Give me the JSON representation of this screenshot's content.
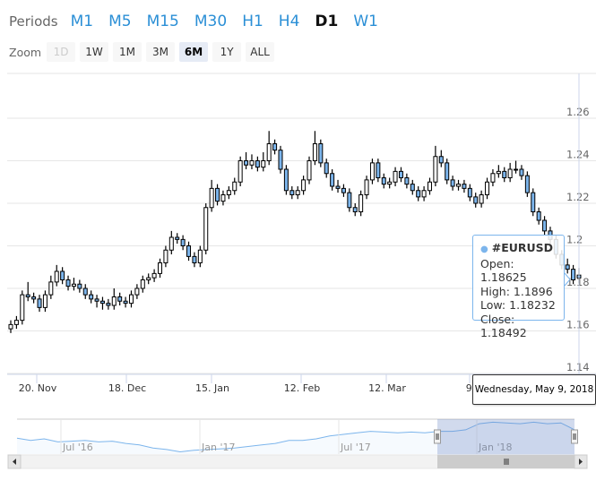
{
  "periods": {
    "label": "Periods",
    "items": [
      "M1",
      "M5",
      "M15",
      "M30",
      "H1",
      "H4",
      "D1",
      "W1"
    ],
    "active": "D1"
  },
  "zoom": {
    "label": "Zoom",
    "items": [
      "1D",
      "1W",
      "1M",
      "3M",
      "6M",
      "1Y",
      "ALL"
    ],
    "disabled": "1D",
    "selected": "6M"
  },
  "tooltip": {
    "symbol": "#EURUSD",
    "open": "Open: 1.18625",
    "high": "High: 1.1896",
    "low": "Low: 1.18232",
    "close": "Close: 1.18492",
    "date": "Wednesday, May 9, 2018"
  },
  "colors": {
    "down": "#7cb5ec",
    "up": "#ffffff",
    "line": "#000000",
    "grid": "#e6e6e6",
    "accent": "#2b8fd6"
  },
  "chart_data": {
    "type": "candlestick",
    "title": "",
    "series_name": "#EURUSD",
    "ylim": [
      1.14,
      1.26
    ],
    "y_ticks": [
      "1.14",
      "1.16",
      "1.18",
      "1.2",
      "1.22",
      "1.24",
      "1.26"
    ],
    "x_ticks": [
      "20. Nov",
      "18. Dec",
      "15. Jan",
      "12. Feb",
      "12. Mar",
      "9."
    ],
    "ohlc": [
      [
        1.161,
        1.165,
        1.159,
        1.163
      ],
      [
        1.163,
        1.167,
        1.161,
        1.165
      ],
      [
        1.165,
        1.179,
        1.163,
        1.177
      ],
      [
        1.177,
        1.183,
        1.174,
        1.176
      ],
      [
        1.176,
        1.178,
        1.173,
        1.175
      ],
      [
        1.175,
        1.177,
        1.169,
        1.171
      ],
      [
        1.171,
        1.179,
        1.169,
        1.177
      ],
      [
        1.177,
        1.186,
        1.175,
        1.183
      ],
      [
        1.183,
        1.191,
        1.181,
        1.188
      ],
      [
        1.188,
        1.19,
        1.182,
        1.184
      ],
      [
        1.184,
        1.186,
        1.179,
        1.181
      ],
      [
        1.181,
        1.185,
        1.179,
        1.182
      ],
      [
        1.182,
        1.184,
        1.178,
        1.18
      ],
      [
        1.18,
        1.182,
        1.175,
        1.177
      ],
      [
        1.177,
        1.179,
        1.173,
        1.175
      ],
      [
        1.175,
        1.177,
        1.171,
        1.174
      ],
      [
        1.174,
        1.176,
        1.17,
        1.173
      ],
      [
        1.173,
        1.175,
        1.17,
        1.172
      ],
      [
        1.172,
        1.18,
        1.17,
        1.176
      ],
      [
        1.176,
        1.178,
        1.172,
        1.174
      ],
      [
        1.174,
        1.176,
        1.171,
        1.173
      ],
      [
        1.173,
        1.179,
        1.171,
        1.177
      ],
      [
        1.177,
        1.182,
        1.175,
        1.18
      ],
      [
        1.18,
        1.186,
        1.178,
        1.184
      ],
      [
        1.184,
        1.187,
        1.182,
        1.185
      ],
      [
        1.185,
        1.189,
        1.183,
        1.187
      ],
      [
        1.187,
        1.194,
        1.185,
        1.192
      ],
      [
        1.192,
        1.2,
        1.19,
        1.198
      ],
      [
        1.198,
        1.207,
        1.196,
        1.204
      ],
      [
        1.204,
        1.206,
        1.201,
        1.203
      ],
      [
        1.203,
        1.205,
        1.198,
        1.2
      ],
      [
        1.2,
        1.202,
        1.193,
        1.195
      ],
      [
        1.195,
        1.197,
        1.19,
        1.192
      ],
      [
        1.192,
        1.2,
        1.19,
        1.198
      ],
      [
        1.198,
        1.22,
        1.196,
        1.218
      ],
      [
        1.218,
        1.231,
        1.216,
        1.227
      ],
      [
        1.227,
        1.229,
        1.219,
        1.221
      ],
      [
        1.221,
        1.226,
        1.219,
        1.224
      ],
      [
        1.224,
        1.228,
        1.222,
        1.226
      ],
      [
        1.226,
        1.232,
        1.224,
        1.23
      ],
      [
        1.23,
        1.242,
        1.228,
        1.24
      ],
      [
        1.24,
        1.244,
        1.236,
        1.238
      ],
      [
        1.238,
        1.243,
        1.236,
        1.24
      ],
      [
        1.24,
        1.242,
        1.235,
        1.237
      ],
      [
        1.237,
        1.244,
        1.235,
        1.24
      ],
      [
        1.24,
        1.254,
        1.238,
        1.248
      ],
      [
        1.248,
        1.25,
        1.243,
        1.245
      ],
      [
        1.245,
        1.247,
        1.234,
        1.236
      ],
      [
        1.236,
        1.238,
        1.224,
        1.226
      ],
      [
        1.226,
        1.228,
        1.222,
        1.224
      ],
      [
        1.224,
        1.228,
        1.222,
        1.226
      ],
      [
        1.226,
        1.233,
        1.224,
        1.231
      ],
      [
        1.231,
        1.242,
        1.229,
        1.24
      ],
      [
        1.24,
        1.254,
        1.238,
        1.248
      ],
      [
        1.248,
        1.25,
        1.237,
        1.239
      ],
      [
        1.239,
        1.241,
        1.232,
        1.234
      ],
      [
        1.234,
        1.236,
        1.226,
        1.228
      ],
      [
        1.228,
        1.231,
        1.225,
        1.227
      ],
      [
        1.227,
        1.229,
        1.223,
        1.225
      ],
      [
        1.225,
        1.227,
        1.216,
        1.218
      ],
      [
        1.218,
        1.22,
        1.214,
        1.216
      ],
      [
        1.216,
        1.226,
        1.214,
        1.224
      ],
      [
        1.224,
        1.233,
        1.222,
        1.231
      ],
      [
        1.231,
        1.241,
        1.229,
        1.239
      ],
      [
        1.239,
        1.241,
        1.23,
        1.232
      ],
      [
        1.232,
        1.234,
        1.227,
        1.229
      ],
      [
        1.229,
        1.232,
        1.227,
        1.23
      ],
      [
        1.23,
        1.237,
        1.228,
        1.235
      ],
      [
        1.235,
        1.237,
        1.23,
        1.232
      ],
      [
        1.232,
        1.234,
        1.227,
        1.229
      ],
      [
        1.229,
        1.231,
        1.224,
        1.226
      ],
      [
        1.226,
        1.228,
        1.221,
        1.223
      ],
      [
        1.223,
        1.228,
        1.221,
        1.226
      ],
      [
        1.226,
        1.232,
        1.224,
        1.23
      ],
      [
        1.23,
        1.247,
        1.228,
        1.242
      ],
      [
        1.242,
        1.245,
        1.237,
        1.239
      ],
      [
        1.239,
        1.241,
        1.229,
        1.231
      ],
      [
        1.231,
        1.233,
        1.226,
        1.228
      ],
      [
        1.228,
        1.231,
        1.226,
        1.229
      ],
      [
        1.229,
        1.231,
        1.225,
        1.227
      ],
      [
        1.227,
        1.229,
        1.221,
        1.223
      ],
      [
        1.223,
        1.225,
        1.218,
        1.22
      ],
      [
        1.22,
        1.226,
        1.218,
        1.224
      ],
      [
        1.224,
        1.232,
        1.222,
        1.23
      ],
      [
        1.23,
        1.236,
        1.228,
        1.234
      ],
      [
        1.234,
        1.238,
        1.232,
        1.235
      ],
      [
        1.235,
        1.237,
        1.23,
        1.232
      ],
      [
        1.232,
        1.239,
        1.23,
        1.236
      ],
      [
        1.236,
        1.24,
        1.234,
        1.236
      ],
      [
        1.236,
        1.238,
        1.231,
        1.233
      ],
      [
        1.233,
        1.235,
        1.223,
        1.225
      ],
      [
        1.225,
        1.227,
        1.214,
        1.216
      ],
      [
        1.216,
        1.218,
        1.21,
        1.212
      ],
      [
        1.212,
        1.214,
        1.205,
        1.207
      ],
      [
        1.207,
        1.209,
        1.201,
        1.203
      ],
      [
        1.203,
        1.205,
        1.194,
        1.196
      ],
      [
        1.196,
        1.198,
        1.189,
        1.191
      ],
      [
        1.191,
        1.194,
        1.187,
        1.189
      ],
      [
        1.189,
        1.191,
        1.182,
        1.184
      ],
      [
        1.18625,
        1.1896,
        1.18232,
        1.18492
      ]
    ],
    "navigator": {
      "x_ticks": [
        "Jul '16",
        "Jan '17",
        "Jul '17",
        "Jan '18"
      ],
      "ylim": [
        1.03,
        1.26
      ],
      "values": [
        1.135,
        1.12,
        1.13,
        1.11,
        1.115,
        1.12,
        1.11,
        1.115,
        1.1,
        1.09,
        1.07,
        1.06,
        1.045,
        1.055,
        1.06,
        1.065,
        1.07,
        1.08,
        1.09,
        1.1,
        1.12,
        1.12,
        1.13,
        1.15,
        1.16,
        1.17,
        1.18,
        1.175,
        1.17,
        1.175,
        1.17,
        1.18,
        1.18,
        1.19,
        1.23,
        1.24,
        1.235,
        1.23,
        1.24,
        1.23,
        1.235,
        1.19
      ],
      "selected_range": "6M"
    }
  }
}
